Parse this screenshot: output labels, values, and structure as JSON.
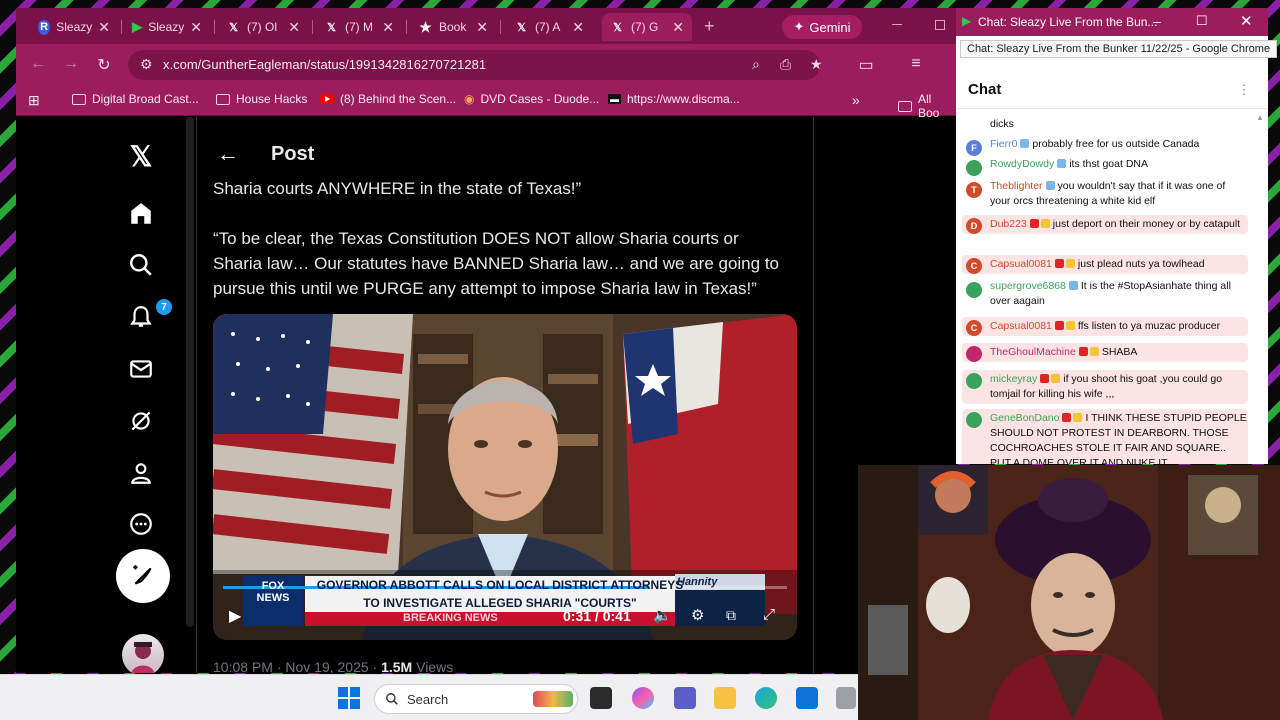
{
  "browser": {
    "tabs": [
      {
        "label": "Sleazy",
        "icon": "r-icon"
      },
      {
        "label": "Sleazy",
        "icon": "play-icon"
      },
      {
        "label": "(7) Ol",
        "icon": "x-logo-icon"
      },
      {
        "label": "(7) M",
        "icon": "x-logo-icon"
      },
      {
        "label": "Book",
        "icon": "star-icon"
      },
      {
        "label": "(7) A",
        "icon": "x-logo-icon"
      },
      {
        "label": "(7) G",
        "icon": "x-logo-icon"
      }
    ],
    "gemini_label": "Gemini",
    "url": "x.com/GuntherEagleman/status/1991342816270721281",
    "bookmarks": [
      {
        "label": "Digital Broad Cast..."
      },
      {
        "label": "House Hacks"
      },
      {
        "label": "(8) Behind the Scen..."
      },
      {
        "label": "DVD Cases - Duode..."
      },
      {
        "label": "https://www.discma..."
      },
      {
        "label": "All Boo"
      }
    ],
    "colors": {
      "tab_bar": "#7a1248",
      "toolbar": "#9c1d5e"
    }
  },
  "xpage": {
    "header_title": "Post",
    "notification_count": "7",
    "text_lines": [
      "Sharia courts ANYWHERE in the state of Texas!”",
      "“To be clear, the Texas Constitution DOES NOT allow Sharia courts or",
      "Sharia law… Our statutes have BANNED Sharia law… and we are going to",
      "pursue this until we PURGE any attempt to impose Sharia law in Texas!”"
    ],
    "video": {
      "network": "FOX NEWS",
      "headline_1": "GOVERNOR ABBOTT CALLS ON LOCAL DISTRICT ATTORNEYS",
      "headline_2": "TO INVESTIGATE ALLEGED SHARIA \"COURTS\"",
      "breaking": "BREAKING NEWS",
      "time_current": "0:31",
      "time_total": "0:41",
      "time_sep": "/",
      "show": "Hannity",
      "progress": 0.756
    },
    "meta_time": "10:08 PM · Nov 19, 2025 · ",
    "meta_views": "1.5M",
    "meta_views_label": " Views"
  },
  "chat_window": {
    "title": "Chat: Sleazy Live From the Bun...",
    "tooltip": "Chat: Sleazy Live From the Bunker 11/22/25 - Google Chrome",
    "header": "Chat",
    "messages": [
      {
        "author": "",
        "text": "dicks",
        "avatar": "",
        "color": "#0f0f0f",
        "highlight": false
      },
      {
        "author": "Fierr0",
        "text": "probably free for us outside Canada",
        "avatar": "F",
        "color": "#5b7fd6",
        "highlight": false
      },
      {
        "author": "RowdyDowdy",
        "text": "its thst goat DNA",
        "avatar": "",
        "color": "#3aa35b",
        "highlight": false
      },
      {
        "author": "Theblighter",
        "text": "you wouldn't say that if it was one of your orcs threatening a white kid elf",
        "avatar": "T",
        "color": "#d04a2c",
        "highlight": false
      },
      {
        "author": "Dub223",
        "text": "just deport on their money or by catapult",
        "avatar": "D",
        "color": "#d04a2c",
        "highlight": true
      },
      {
        "author": "Capsual0081",
        "text": "just plead nuts ya towlhead",
        "avatar": "C",
        "color": "#d04a2c",
        "highlight": true
      },
      {
        "author": "supergrove6868",
        "text": "It is the #StopAsianhate thing all over aagain",
        "avatar": "",
        "color": "#3aa35b",
        "highlight": false
      },
      {
        "author": "Capsual0081",
        "text": "ffs listen to ya muzac producer",
        "avatar": "C",
        "color": "#d04a2c",
        "highlight": true
      },
      {
        "author": "TheGhoulMachine",
        "text": "SHABA",
        "avatar": "",
        "color": "#c0266b",
        "highlight": true
      },
      {
        "author": "mickeyray",
        "text": "if you shoot his goat ,you could go tomjail for killing his wife ,,,",
        "avatar": "",
        "color": "#3aa35b",
        "highlight": true
      },
      {
        "author": "GeneBonDano",
        "text": "I THINK THESE STUPID PEOPLE SHOULD NOT PROTEST IN DEARBORN. THOSE COCHROACHES STOLE IT FAIR AND SQUARE.. PUT A DOME OVER IT AND NUKE IT",
        "avatar": "",
        "color": "#3aa35b",
        "highlight": true
      }
    ]
  },
  "taskbar": {
    "search_label": "Search"
  }
}
